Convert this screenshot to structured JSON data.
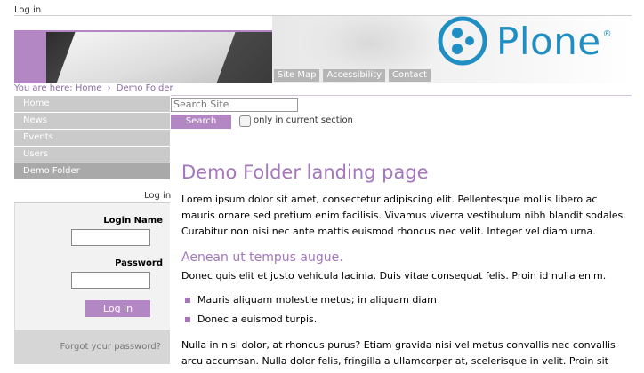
{
  "header": {
    "top_login": "Log in",
    "site_actions": [
      "Site Map",
      "Accessibility",
      "Contact"
    ],
    "logo_text": "Plone",
    "logo_mark": "®",
    "brand_color": "#1f8ec3",
    "accent_color": "#b386c4"
  },
  "breadcrumbs": {
    "prefix": "You are here:",
    "items": [
      "Home",
      "Demo Folder"
    ],
    "separator": "›"
  },
  "search": {
    "placeholder": "Search Site",
    "button_label": "Search",
    "checkbox_label": "only in current section"
  },
  "navigation": {
    "items": [
      {
        "label": "Home"
      },
      {
        "label": "News"
      },
      {
        "label": "Events"
      },
      {
        "label": "Users"
      },
      {
        "label": "Demo Folder"
      }
    ]
  },
  "login_portlet": {
    "header_link": "Log in",
    "login_name_label": "Login Name",
    "password_label": "Password",
    "button_label": "Log in",
    "forgot_link": "Forgot your password?"
  },
  "content": {
    "title": "Demo Folder landing page",
    "intro": "Lorem ipsum dolor sit amet, consectetur adipiscing elit. Pellentesque mollis libero ac mauris ornare sed pretium enim facilisis. Vivamus viverra vestibulum nibh blandit sodales. Curabitur non nisi nec ante mattis euismod rhoncus nec velit. Integer vel diam urna.",
    "subheading": "Aenean ut tempus augue.",
    "paragraph2": "Donec quis elit et justo vehicula lacinia. Duis vitae consequat felis. Proin id nulla enim.",
    "bullets": [
      "Mauris aliquam molestie metus; in aliquam diam",
      "Donec a euismod turpis."
    ],
    "paragraph3": "Nulla in nisl dolor, at rhoncus purus? Etiam gravida nisi vel metus convallis nec convallis arcu accumsan. Nulla dolor felis, fringilla a ullamcorper at, scelerisque in velit. Proin sit"
  }
}
